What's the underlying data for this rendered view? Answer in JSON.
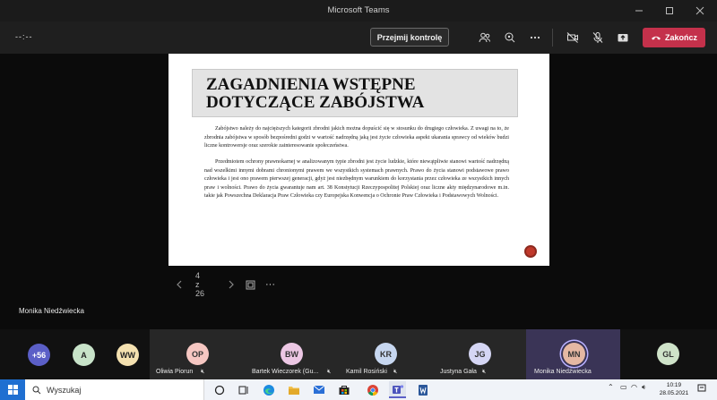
{
  "window": {
    "title": "Microsoft Teams"
  },
  "meeting": {
    "timer": "--:--",
    "take_control_label": "Przejmij kontrolę",
    "end_label": "Zakończ",
    "end_color": "#c4314b"
  },
  "slide": {
    "heading": "ZAGADNIENIA WSTĘPNE DOTYCZĄCE ZABÓJSTWA",
    "paragraph1": "Zabójstwo należy do najcięższych kategorii zbrodni jakich można dopuścić się w stosunku do drugiego człowieka. Z uwagi na to, że zbrodnia zabójstwa w sposób bezpośredni godzi w wartość nadrzędną jaką jest życie człowieka aspekt ukarania sprawcy od wieków budzi liczne kontrowersje oraz szerokie zainteresowanie społeczeństwa.",
    "paragraph2": "Przedmiotem ochrony prawnokarnej w analizowanym typie zbrodni jest życie ludzkie, które niewątpliwie stanowi wartość nadrzędną nad wszelkimi innymi dobrami chronionymi prawem we wszystkich systemach prawnych. Prawo do życia stanowi podstawowe prawo człowieka i jest ono prawem pierwszej generacji, gdyż jest niezbędnym warunkiem do korzystania przez człowieka ze wszystkich innych praw i wolności. Prawo do życia gwarantuje nam art. 38 Konstytucji Rzeczypospolitej Polskiej oraz liczne akty międzynarodowe m.in. takie jak Powszechna Deklaracja Praw Człowieka czy Europejska Konwencja o Ochronie Praw Człowieka i Podstawowych Wolności."
  },
  "pager": {
    "page": "4 z 26",
    "more": "···"
  },
  "presenter_name": "Monika Niedźwiecka",
  "participants": {
    "overflow": {
      "label": "+56",
      "color": "#5b5fc7"
    },
    "small": [
      {
        "initials": "A",
        "color": "#c8e3c9"
      },
      {
        "initials": "WW",
        "color": "#f4e1b0"
      }
    ],
    "tiles": [
      {
        "initials": "OP",
        "name": "Oliwia Piorun",
        "color": "#f6c7c2",
        "active": false
      },
      {
        "initials": "BW",
        "name": "Bartek Wieczorek (Gu...",
        "color": "#ecc7e4",
        "active": false
      },
      {
        "initials": "KR",
        "name": "Kamil Rosiński",
        "color": "#c7d7f0",
        "active": false
      },
      {
        "initials": "JG",
        "name": "Justyna Gała",
        "color": "#d5d6f4",
        "active": false
      },
      {
        "initials": "MN",
        "name": "Monika Niedźwiecka",
        "color": "#e5b8a3",
        "active": true
      }
    ],
    "last": {
      "initials": "GL",
      "color": "#cfe3c9"
    }
  },
  "taskbar": {
    "search_placeholder": "Wyszukaj",
    "time": "10:19",
    "date": "28.05.2021"
  }
}
